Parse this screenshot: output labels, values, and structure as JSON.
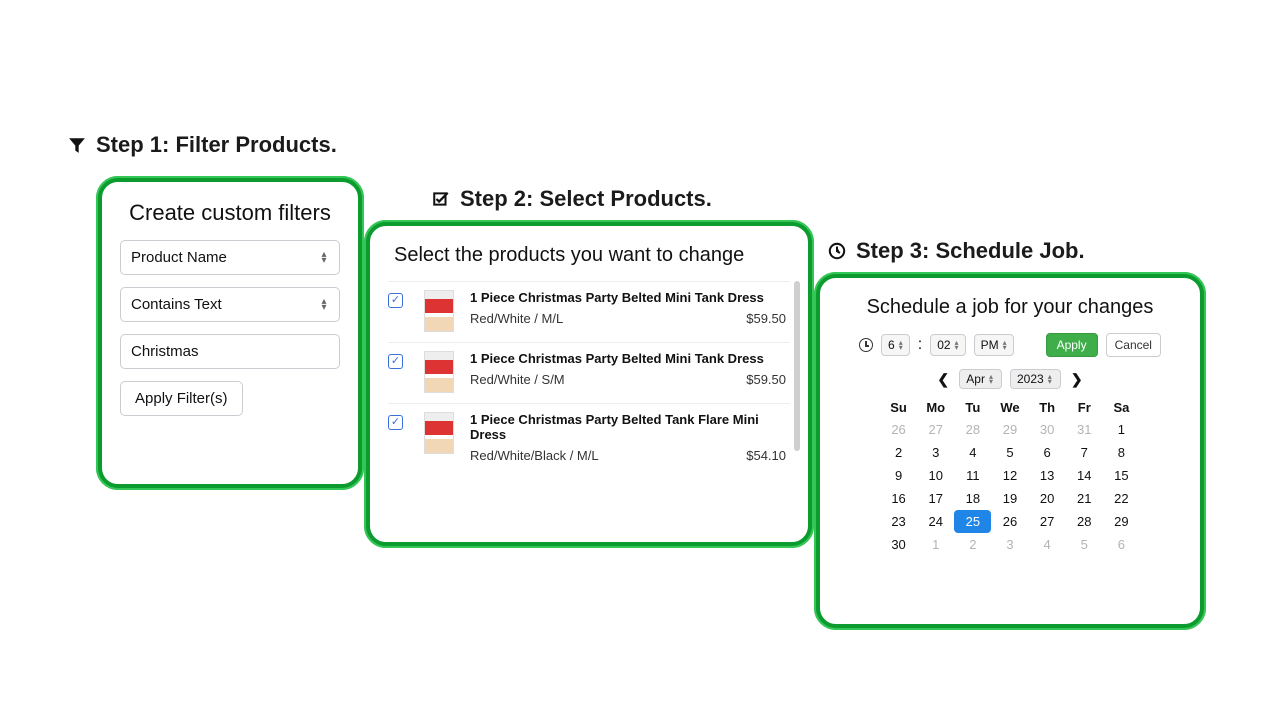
{
  "step1": {
    "heading": "Step 1: Filter Products.",
    "card_title": "Create custom filters",
    "select_field": "Product Name",
    "operator_field": "Contains Text",
    "value_field": "Christmas",
    "apply_label": "Apply Filter(s)"
  },
  "step2": {
    "heading": "Step 2: Select Products.",
    "card_title": "Select the products you want to change",
    "products": [
      {
        "title": "1 Piece Christmas Party Belted Mini Tank Dress",
        "variant": "Red/White / M/L",
        "price": "$59.50"
      },
      {
        "title": "1 Piece Christmas Party Belted Mini Tank Dress",
        "variant": "Red/White / S/M",
        "price": "$59.50"
      },
      {
        "title": "1 Piece Christmas Party Belted Tank Flare Mini Dress",
        "variant": "Red/White/Black / M/L",
        "price": "$54.10"
      }
    ]
  },
  "step3": {
    "heading": "Step 3: Schedule Job.",
    "card_title": "Schedule a job for your changes",
    "time": {
      "hour": "6",
      "minute": "02",
      "ampm": "PM",
      "colon": ":"
    },
    "apply_label": "Apply",
    "cancel_label": "Cancel",
    "month": "Apr",
    "year": "2023",
    "dow": [
      "Su",
      "Mo",
      "Tu",
      "We",
      "Th",
      "Fr",
      "Sa"
    ],
    "weeks": [
      [
        {
          "d": "26",
          "o": true
        },
        {
          "d": "27",
          "o": true
        },
        {
          "d": "28",
          "o": true
        },
        {
          "d": "29",
          "o": true
        },
        {
          "d": "30",
          "o": true
        },
        {
          "d": "31",
          "o": true
        },
        {
          "d": "1"
        }
      ],
      [
        {
          "d": "2"
        },
        {
          "d": "3"
        },
        {
          "d": "4"
        },
        {
          "d": "5"
        },
        {
          "d": "6"
        },
        {
          "d": "7"
        },
        {
          "d": "8"
        }
      ],
      [
        {
          "d": "9"
        },
        {
          "d": "10"
        },
        {
          "d": "11"
        },
        {
          "d": "12"
        },
        {
          "d": "13"
        },
        {
          "d": "14"
        },
        {
          "d": "15"
        }
      ],
      [
        {
          "d": "16"
        },
        {
          "d": "17"
        },
        {
          "d": "18"
        },
        {
          "d": "19"
        },
        {
          "d": "20"
        },
        {
          "d": "21"
        },
        {
          "d": "22"
        }
      ],
      [
        {
          "d": "23"
        },
        {
          "d": "24"
        },
        {
          "d": "25",
          "sel": true
        },
        {
          "d": "26"
        },
        {
          "d": "27"
        },
        {
          "d": "28"
        },
        {
          "d": "29"
        }
      ],
      [
        {
          "d": "30"
        },
        {
          "d": "1",
          "o": true
        },
        {
          "d": "2",
          "o": true
        },
        {
          "d": "3",
          "o": true
        },
        {
          "d": "4",
          "o": true
        },
        {
          "d": "5",
          "o": true
        },
        {
          "d": "6",
          "o": true
        }
      ]
    ]
  }
}
